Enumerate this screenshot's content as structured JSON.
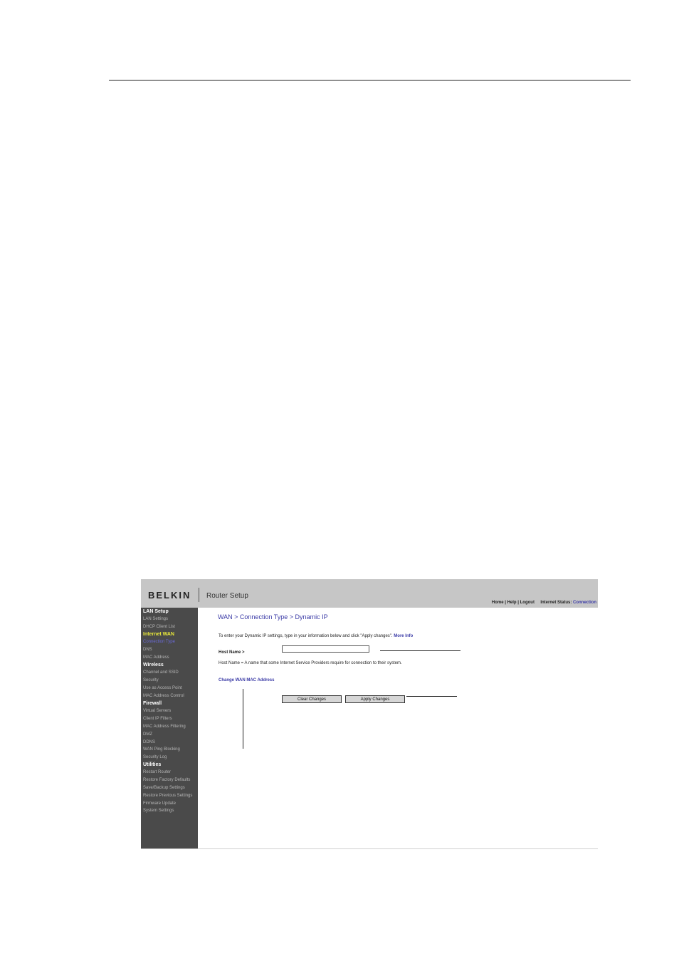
{
  "header": {
    "logo": "BELKIN",
    "title": "Router Setup",
    "links": [
      "Home",
      "Help",
      "Logout"
    ],
    "status_label": "Internet Status:",
    "status_value": "Connection"
  },
  "sidebar": {
    "lan_setup": "LAN Setup",
    "lan_settings": "LAN Settings",
    "dhcp_client_list": "DHCP Client List",
    "internet_wan": "Internet WAN",
    "connection_type": "Connection Type",
    "dns": "DNS",
    "mac_address": "MAC Address",
    "wireless": "Wireless",
    "channel_ssid": "Channel and SSID",
    "security": "Security",
    "use_as_access_point": "Use as Access Point",
    "mac_address_control": "MAC Address Control",
    "firewall": "Firewall",
    "virtual_servers": "Virtual Servers",
    "client_ip_filters": "Client IP Filters",
    "mac_address_filtering": "MAC Address Filtering",
    "dmz": "DMZ",
    "ddns": "DDNS",
    "wan_ping_blocking": "WAN Ping Blocking",
    "security_log": "Security Log",
    "utilities": "Utilities",
    "restart_router": "Restart Router",
    "restore_factory_defaults": "Restore Factory Defaults",
    "save_backup_settings": "Save/Backup Settings",
    "restore_previous_settings": "Restore Previous Settings",
    "firmware_update": "Firmware Update",
    "system_settings": "System Settings"
  },
  "main": {
    "title": "WAN > Connection Type > Dynamic IP",
    "intro": "To enter your Dynamic IP settings, type in your information below and click \"Apply changes\".",
    "more_info": "More Info",
    "host_name_label": "Host Name >",
    "host_name_value": "",
    "host_name_desc": "Host Name = A name that some Internet Service Providers require for connection to their system.",
    "change_mac_link": "Change WAN MAC Address",
    "clear_button": "Clear Changes",
    "apply_button": "Apply Changes"
  },
  "colors": {
    "header_bg": "#c6c6c6",
    "sidebar_bg": "#4a4a4a",
    "link_blue": "#3a3aa6",
    "active_section": "#e8e83a"
  }
}
